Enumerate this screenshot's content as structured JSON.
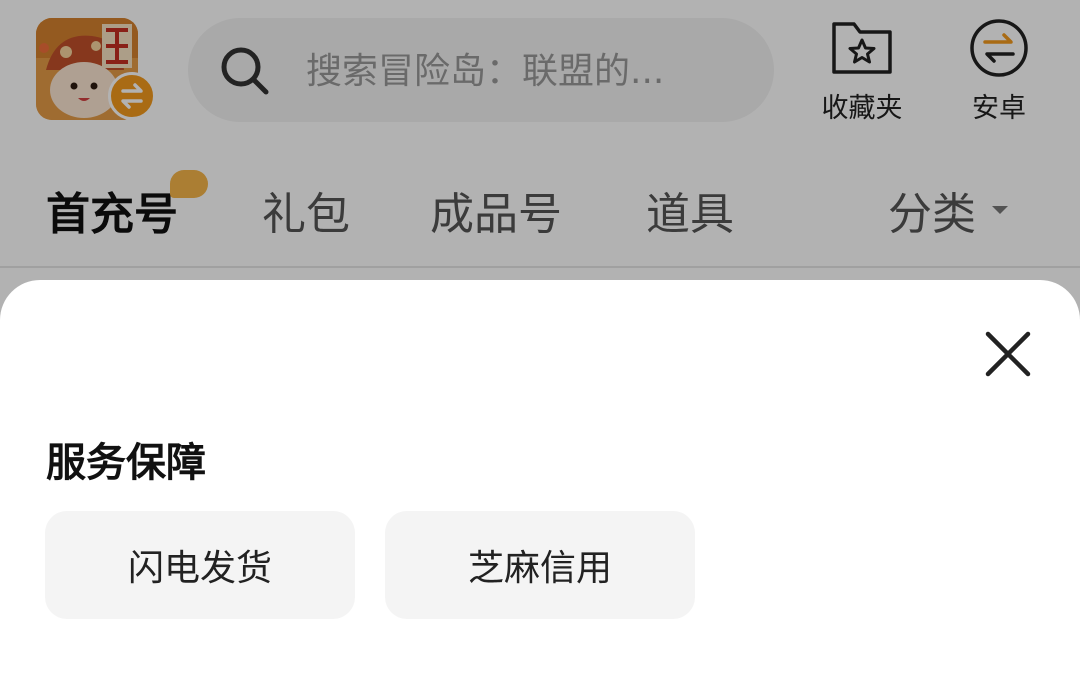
{
  "header": {
    "search_placeholder": "搜索冒险岛：联盟的...",
    "favorites_label": "收藏夹",
    "android_label": "安卓",
    "logo_text": "正版",
    "colors": {
      "logo_orange": "#f29a1d",
      "search_bg": "#f2f2f2"
    }
  },
  "tabs": {
    "items": [
      {
        "label": "首充号",
        "active": true
      },
      {
        "label": "礼包"
      },
      {
        "label": "成品号"
      },
      {
        "label": "道具"
      }
    ],
    "category_label": "分类"
  },
  "sheet": {
    "title": "服务保障",
    "options": [
      {
        "label": "闪电发货"
      },
      {
        "label": "芝麻信用"
      }
    ]
  },
  "icons": {
    "search": "search-icon",
    "favorites": "star-folder-icon",
    "android": "swap-circle-icon",
    "close": "close-icon"
  }
}
